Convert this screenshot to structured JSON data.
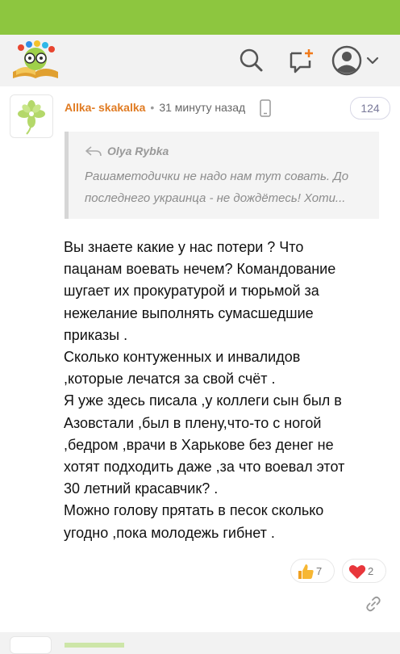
{
  "comment": {
    "author": "Allka- skakalka",
    "time": "31 минуту назад",
    "count": "124",
    "quote": {
      "author": "Olya Rybka",
      "lines": [
        "Рашаметодички не надо нам тут совать. До",
        "последнего украинца - не дождётесь! Хоти..."
      ]
    },
    "body_lines": [
      "Вы знаете какие у нас потери ? Что",
      "пацанам воевать нечем? Командование",
      "шугает их прокуратурой и тюрьмой за",
      "нежелание выполнять сумасшедшие",
      "приказы .",
      "Сколько контуженных и инвалидов",
      ",которые лечатся за свой счёт .",
      "Я уже здесь писала ,у коллеги сын был в",
      "Азовстали ,был в плену,что-то с ногой",
      ",бедром ,врачи в Харькове без денег не",
      "хотят подходить даже ,за что воевал этот",
      "30 летний красавчик? .",
      "Можно голову прятать в песок сколько",
      "угодно ,пока молодежь гибнет ."
    ],
    "reactions": {
      "like_count": "7",
      "heart_count": "2"
    }
  },
  "icons": {
    "logo": "bookworm-logo-icon",
    "search": "search-icon",
    "new_message": "new-message-icon",
    "profile": "user-avatar-icon",
    "profile_menu": "chevron-down-icon",
    "device": "mobile-phone-icon",
    "reply": "reply-arrow-icon",
    "like": "thumbs-up-icon",
    "heart": "heart-icon",
    "share": "link-icon"
  },
  "colors": {
    "topbar": "#8dc63f",
    "author": "#e07b22",
    "background": "#f2f2f2"
  }
}
